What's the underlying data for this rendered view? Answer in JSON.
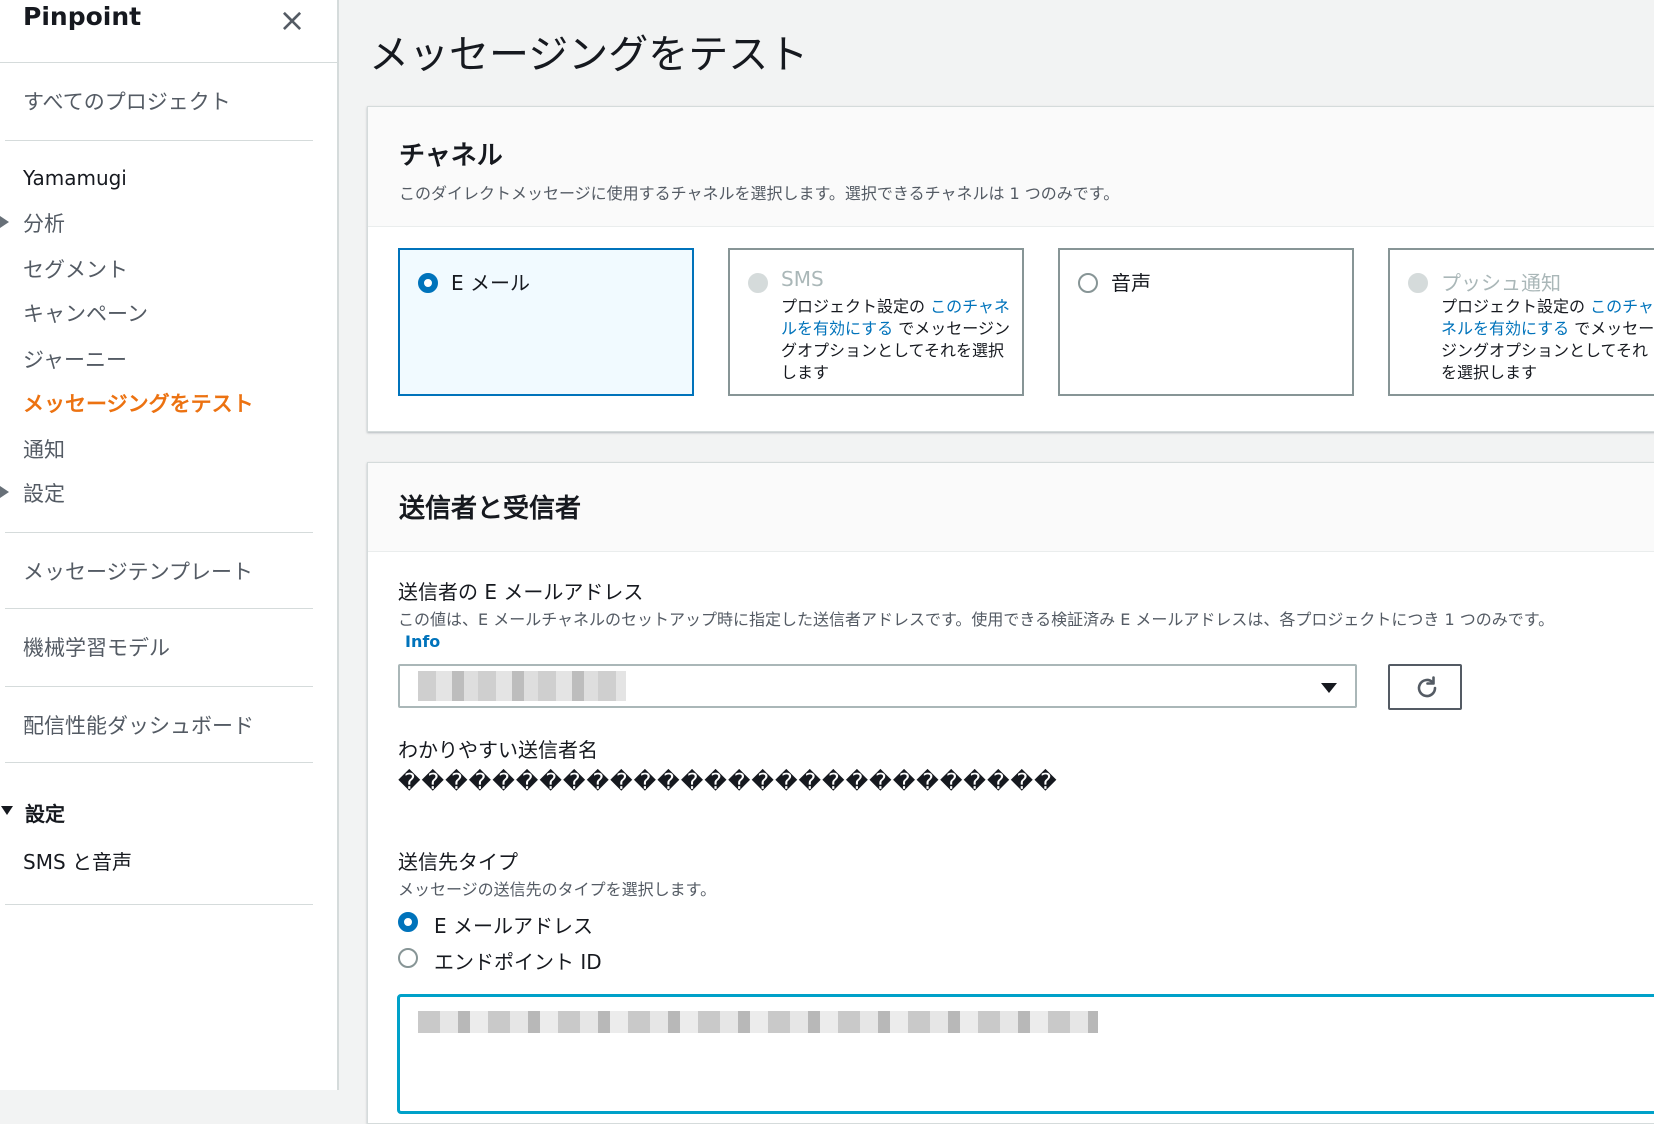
{
  "sidebar": {
    "brand": "Pinpoint",
    "close": "×",
    "all_projects": "すべてのプロジェクト",
    "project_name": "Yamamugi",
    "items": [
      {
        "label": "分析"
      },
      {
        "label": "セグメント"
      },
      {
        "label": "キャンペーン"
      },
      {
        "label": "ジャーニー"
      },
      {
        "label": "メッセージングをテスト"
      },
      {
        "label": "通知"
      },
      {
        "label": "設定"
      }
    ],
    "message_templates": "メッセージテンプレート",
    "ml_models": "機械学習モデル",
    "deliverability_dashboard": "配信性能ダッシュボード",
    "settings_section": "設定",
    "sms_voice": "SMS と音声"
  },
  "page": {
    "title": "メッセージングをテスト"
  },
  "channel": {
    "title": "チャネル",
    "description": "このダイレクトメッセージに使用するチャネルを選択します。選択できるチャネルは 1 つのみです。",
    "tiles": [
      {
        "label": "E メール",
        "state": "selected"
      },
      {
        "label": "SMS",
        "state": "disabled",
        "desc_prefix": "プロジェクト設定の ",
        "desc_link": "このチャネルを有効にする",
        "desc_suffix": " でメッセージングオプションとしてそれを選択します"
      },
      {
        "label": "音声",
        "state": "enabled"
      },
      {
        "label": "プッシュ通知",
        "state": "disabled",
        "desc_prefix": "プロジェクト設定の ",
        "desc_link": "このチャネルを有効にする",
        "desc_suffix": " でメッセージングオプションとしてそれを選択します"
      }
    ]
  },
  "sender": {
    "title": "送信者と受信者",
    "from_label": "送信者の E メールアドレス",
    "from_desc": "この値は、E メールチャネルのセットアップ時に指定した送信者アドレスです。使用できる検証済み E メールアドレスは、各プロジェクトにつき 1 つのみです。",
    "info_link": "Info",
    "from_value": "",
    "friendly_label": "わかりやすい送信者名",
    "friendly_value": "����������������������������",
    "dest_label": "送信先タイプ",
    "dest_desc": "メッセージの送信先のタイプを選択します。",
    "dest_options": [
      {
        "label": "E メールアドレス",
        "checked": true
      },
      {
        "label": "エンドポイント ID",
        "checked": false
      }
    ],
    "recipients_value": ""
  },
  "colors": {
    "accent": "#0073bb",
    "active_nav": "#ec7211",
    "focus": "#00a1c9"
  }
}
